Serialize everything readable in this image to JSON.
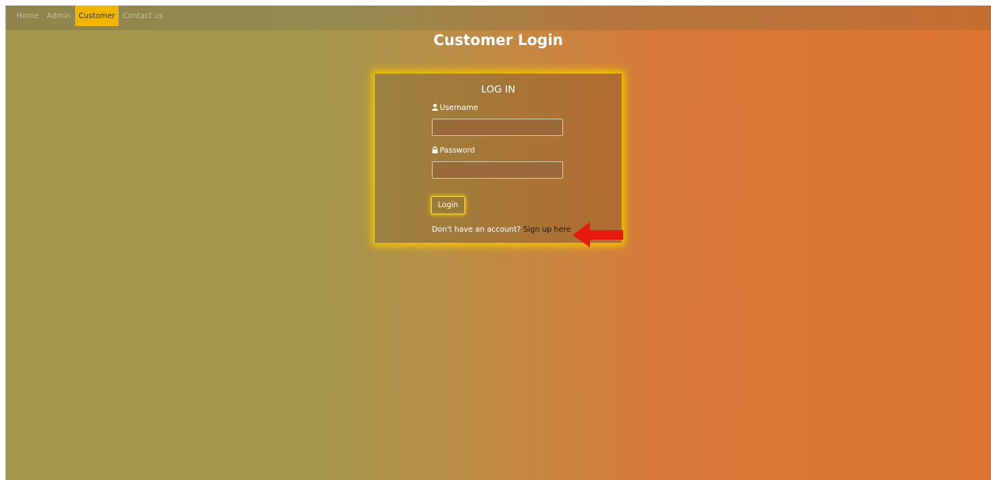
{
  "nav": {
    "items": [
      {
        "label": "Home"
      },
      {
        "label": "Admin"
      },
      {
        "label": "Customer",
        "active": true
      },
      {
        "label": "Contact us"
      }
    ]
  },
  "page": {
    "title": "Customer Login"
  },
  "login": {
    "heading": "LOG IN",
    "username_label": "Username",
    "username_value": "",
    "password_label": "Password",
    "password_value": "",
    "button_label": "Login",
    "signup_prompt": "Don't have an account?",
    "signup_link": "Sign up here"
  },
  "icons": {
    "username": "user-icon",
    "password": "lock-icon",
    "annotation": "red-arrow-icon"
  },
  "colors": {
    "nav_active": "#f2b600",
    "card_glow": "#f0c200",
    "arrow": "#e8190e"
  }
}
